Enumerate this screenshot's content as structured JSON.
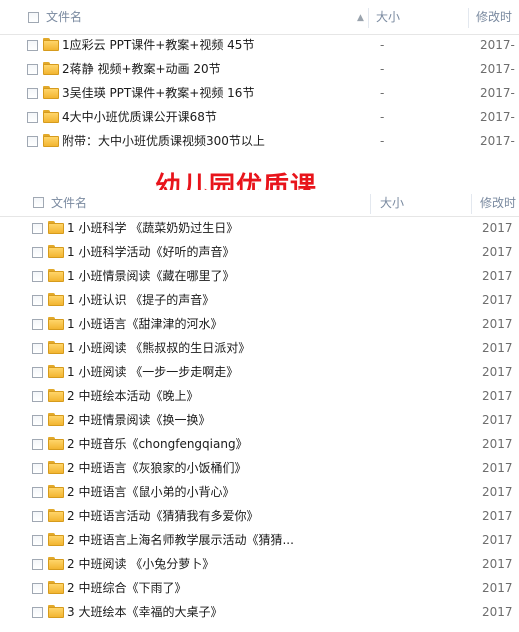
{
  "top": {
    "headers": {
      "name": "文件名",
      "size": "大小",
      "date": "修改时"
    },
    "rows": [
      {
        "name": "1应彩云 PPT课件+教案+视频 45节",
        "size": "-",
        "date": "2017-"
      },
      {
        "name": "2蒋静 视频+教案+动画 20节",
        "size": "-",
        "date": "2017-"
      },
      {
        "name": "3吴佳瑛 PPT课件+教案+视频 16节",
        "size": "-",
        "date": "2017-"
      },
      {
        "name": "4大中小班优质课公开课68节",
        "size": "-",
        "date": "2017-"
      },
      {
        "name": "附带：大中小班优质课视频300节以上",
        "size": "-",
        "date": "2017-"
      }
    ]
  },
  "banner": "幼儿园优质课",
  "bottom": {
    "headers": {
      "name": "文件名",
      "size": "大小",
      "date": "修改时"
    },
    "rows": [
      {
        "name": "1 小班科学 《蔬菜奶奶过生日》",
        "size": "",
        "date": "2017"
      },
      {
        "name": "1 小班科学活动《好听的声音》",
        "size": "",
        "date": "2017"
      },
      {
        "name": "1 小班情景阅读《藏在哪里了》",
        "size": "",
        "date": "2017"
      },
      {
        "name": "1 小班认识 《提子的声音》",
        "size": "",
        "date": "2017"
      },
      {
        "name": "1 小班语言《甜津津的河水》",
        "size": "",
        "date": "2017"
      },
      {
        "name": "1 小班阅读 《熊叔叔的生日派对》",
        "size": "",
        "date": "2017"
      },
      {
        "name": "1 小班阅读 《一步一步走啊走》",
        "size": "",
        "date": "2017"
      },
      {
        "name": "2 中班绘本活动《晚上》",
        "size": "",
        "date": "2017"
      },
      {
        "name": "2 中班情景阅读《换一换》",
        "size": "",
        "date": "2017"
      },
      {
        "name": "2 中班音乐《chongfengqiang》",
        "size": "",
        "date": "2017"
      },
      {
        "name": "2 中班语言《灰狼家的小饭桶们》",
        "size": "",
        "date": "2017"
      },
      {
        "name": "2 中班语言《鼠小弟的小背心》",
        "size": "",
        "date": "2017"
      },
      {
        "name": "2 中班语言活动《猜猜我有多爱你》",
        "size": "",
        "date": "2017"
      },
      {
        "name": "2 中班语言上海名师教学展示活动《猜猜...",
        "size": "",
        "date": "2017"
      },
      {
        "name": "2 中班阅读 《小兔分萝卜》",
        "size": "",
        "date": "2017"
      },
      {
        "name": "2 中班综合《下雨了》",
        "size": "",
        "date": "2017"
      },
      {
        "name": "3 大班绘本《幸福的大桌子》",
        "size": "",
        "date": "2017"
      }
    ]
  }
}
